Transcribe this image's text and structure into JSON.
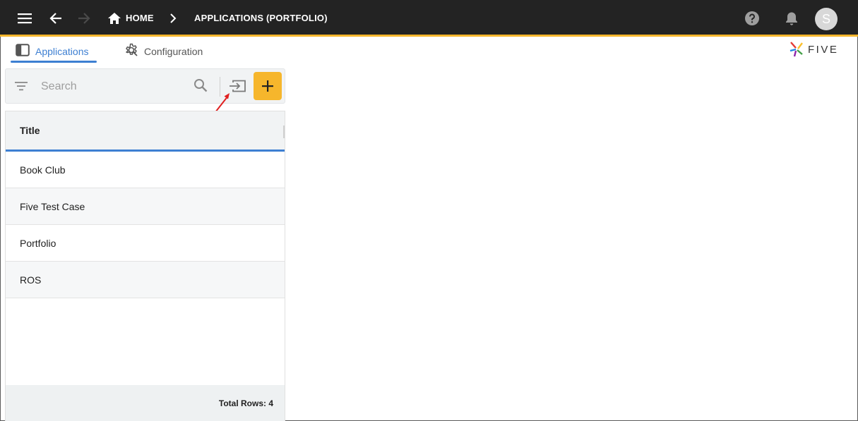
{
  "appbar": {
    "breadcrumb_home": "HOME",
    "breadcrumb_current": "APPLICATIONS (PORTFOLIO)",
    "avatar_initial": "S",
    "accent_color": "#f6b62c",
    "background_color": "#232323"
  },
  "tabs": [
    {
      "label": "Applications",
      "icon": "panel-icon",
      "active": true
    },
    {
      "label": "Configuration",
      "icon": "gear-icon",
      "active": false
    }
  ],
  "logo": {
    "text": "FIVE"
  },
  "search": {
    "placeholder": "Search",
    "value": ""
  },
  "list": {
    "column_header": "Title",
    "rows": [
      "Book Club",
      "Five Test Case",
      "Portfolio",
      "ROS"
    ],
    "footer": "Total Rows: 4"
  },
  "colors": {
    "primary": "#3d7fd2",
    "annotation_arrow": "#e02020"
  }
}
